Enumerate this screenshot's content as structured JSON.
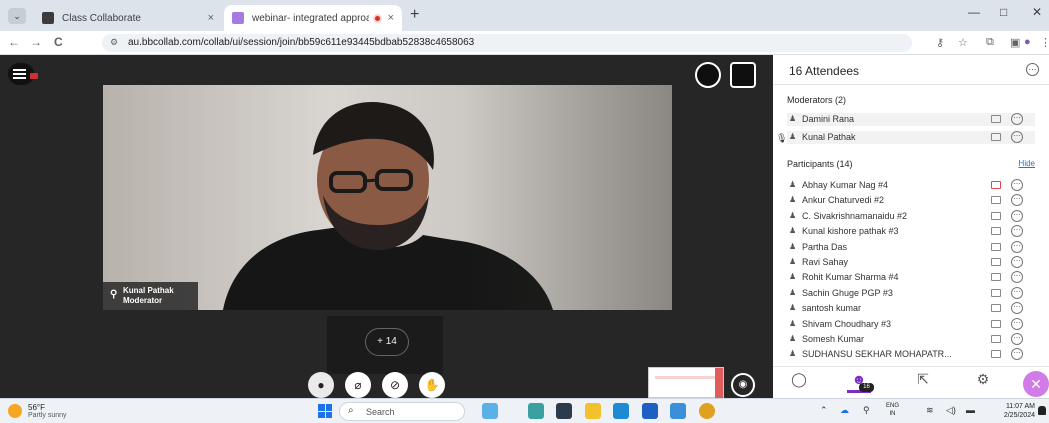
{
  "browser": {
    "tabs": [
      {
        "title": "Class Collaborate",
        "close": "×"
      },
      {
        "title": "webinar- integrated approa",
        "close": "×"
      }
    ],
    "new_tab": "+",
    "window_controls": [
      "—",
      "□",
      "✕"
    ],
    "url": "au.bbcollab.com/collab/ui/session/join/bb59c611e93445bdbab52838c4658063",
    "nav": {
      "back": "←",
      "forward": "→",
      "reload": "C"
    }
  },
  "stage": {
    "presenter_name": "Kunal Pathak",
    "presenter_role": "Moderator",
    "more_participants": "+ 14"
  },
  "panel": {
    "title": "16 Attendees",
    "moderators_header": "Moderators (2)",
    "moderators": [
      {
        "name": "Damini Rana",
        "speaking": false
      },
      {
        "name": "Kunal Pathak",
        "speaking": true
      }
    ],
    "participants_header": "Participants (14)",
    "hide_label": "Hide",
    "participants": [
      {
        "name": "Abhay Kumar Nag #4",
        "caption_red": true
      },
      {
        "name": "Ankur Chaturvedi #2",
        "caption_red": false
      },
      {
        "name": "C. Sivakrishnamanaidu #2",
        "caption_red": false
      },
      {
        "name": "Kunal kishore pathak #3",
        "caption_red": false
      },
      {
        "name": "Partha Das",
        "caption_red": false
      },
      {
        "name": "Ravi Sahay",
        "caption_red": false
      },
      {
        "name": "Rohit Kumar Sharma #4",
        "caption_red": false
      },
      {
        "name": "Sachin Ghuge PGP #3",
        "caption_red": false
      },
      {
        "name": "santosh kumar",
        "caption_red": false
      },
      {
        "name": "Shivam Choudhary #3",
        "caption_red": false
      },
      {
        "name": "Somesh Kumar",
        "caption_red": false
      },
      {
        "name": "SUDHANSU SEKHAR MOHAPATR...",
        "caption_red": false
      }
    ],
    "attendee_badge": "16"
  },
  "taskbar": {
    "temperature": "56°F",
    "condition": "Partly sunny",
    "search_label": "Search",
    "lang_line1": "ENG",
    "lang_line2": "IN",
    "time": "11:07 AM",
    "date": "2/25/2024"
  },
  "colors": {
    "accent_purple": "#7a2fc2",
    "panel_close_pink": "#d17be6",
    "link_blue": "#2a6fdb",
    "stage_bg": "#262626"
  }
}
